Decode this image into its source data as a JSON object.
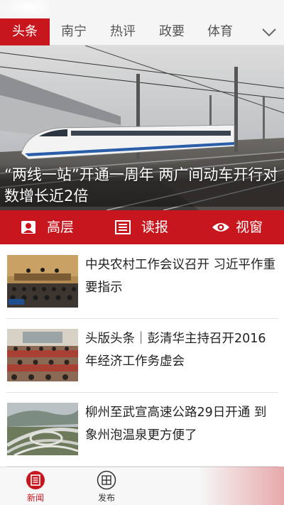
{
  "tabs": [
    {
      "label": "头条",
      "active": true
    },
    {
      "label": "南宁"
    },
    {
      "label": "热评"
    },
    {
      "label": "政要"
    },
    {
      "label": "体育"
    }
  ],
  "more_icon": "chevron-down-icon",
  "hero": {
    "caption": "“两线一站”开通一周年 两广间动车开行对数增长近2倍"
  },
  "actions": [
    {
      "label": "高层",
      "icon": "person-icon"
    },
    {
      "label": "读报",
      "icon": "newspaper-icon"
    },
    {
      "label": "视窗",
      "icon": "eye-icon"
    }
  ],
  "news": [
    {
      "title": "中央农村工作会议召开 习近平作重要指示"
    },
    {
      "title": "头版头条｜彭清华主持召开2016年经济工作务虚会"
    },
    {
      "title": "柳州至武宣高速公路29日开通 到象州泡温泉更方便了"
    }
  ],
  "bottom_nav": [
    {
      "label": "新闻",
      "icon": "newspaper-icon",
      "active": true
    },
    {
      "label": "发布",
      "icon": "grid-circle-icon"
    }
  ],
  "colors": {
    "accent": "#c8161e"
  }
}
